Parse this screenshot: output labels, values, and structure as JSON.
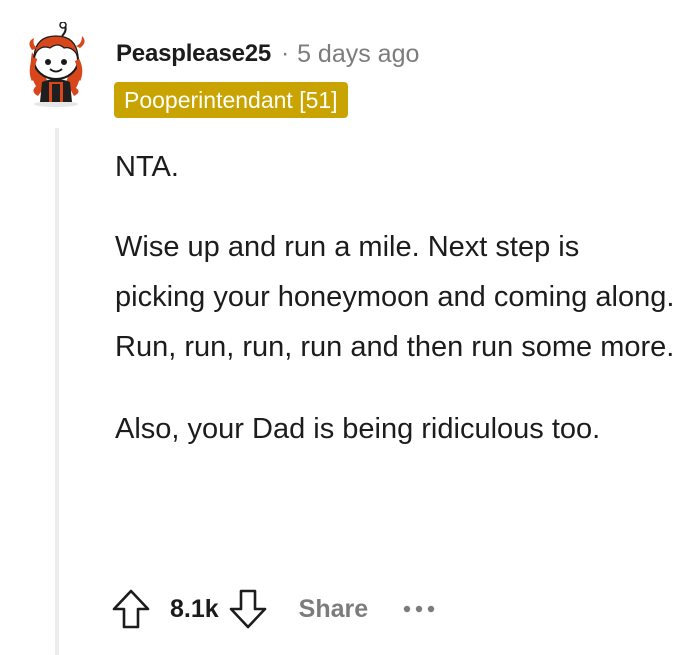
{
  "comment": {
    "author": "Peasplease25",
    "separator": "·",
    "timestamp": "5 days ago",
    "flair": "Pooperintendant [51]",
    "paragraphs": [
      "NTA.",
      "Wise up and run a mile. Next step is picking your honeymoon and coming along. Run, run, run, run and then run some more.",
      "Also, your Dad is being ridiculous too."
    ],
    "score": "8.1k",
    "share_label": "Share",
    "icons": {
      "avatar": "avatar",
      "upvote": "upvote-arrow-icon",
      "downvote": "downvote-arrow-icon",
      "more": "more-options-icon"
    },
    "colors": {
      "flair_background": "#c9a400",
      "flair_text": "#ffffff",
      "meta_text": "#7c7c7c",
      "thread_line": "#ececec"
    }
  }
}
